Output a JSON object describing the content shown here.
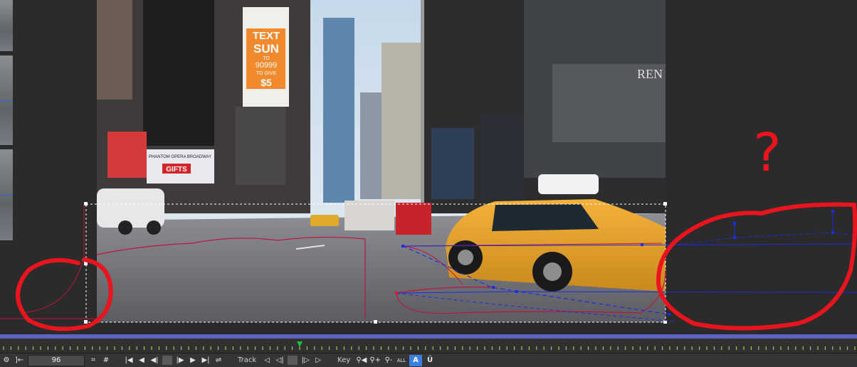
{
  "thumbnail_strip": {
    "items": [
      {
        "label": ""
      },
      {
        "label": ""
      },
      {
        "label": ""
      }
    ]
  },
  "viewer": {
    "billboards": {
      "text_sun": {
        "line1": "TEXT",
        "line2": "SUN",
        "line3": "TO",
        "line4": "90999",
        "line5": "TO GIVE",
        "line6": "$5"
      },
      "gifts": "GIFTS",
      "phantom": "PHANTOM OPERA BROADWAY",
      "ren": "REN"
    }
  },
  "annotation": {
    "question_mark": "?"
  },
  "timeline": {
    "playhead_percent": 35
  },
  "toolbar": {
    "frame_value": "96",
    "track_label": "Track",
    "key_label": "Key",
    "buttons": {
      "first": "|◀",
      "prev_key": "◀",
      "prev_frame": "◀|",
      "stop": "■",
      "next_frame": "|▶",
      "play": "▶",
      "last": "▶|",
      "loop": "⇌",
      "track_back": "◁",
      "track_back_step": "◁|",
      "track_stop": "■",
      "track_fwd_step": "|▷",
      "track_fwd": "▷",
      "key_prev": "⚲◀",
      "key_add": "⚲+",
      "key_del": "⚲-",
      "key_all": "ALL",
      "key_auto": "A",
      "key_u": "Ü"
    }
  },
  "colors": {
    "annotation_red": "#e8141e",
    "spline_blue": "#1a2ee0",
    "mask_red": "#c0143c",
    "timeline_bar": "#5d62c0",
    "playhead": "#18c23a"
  }
}
